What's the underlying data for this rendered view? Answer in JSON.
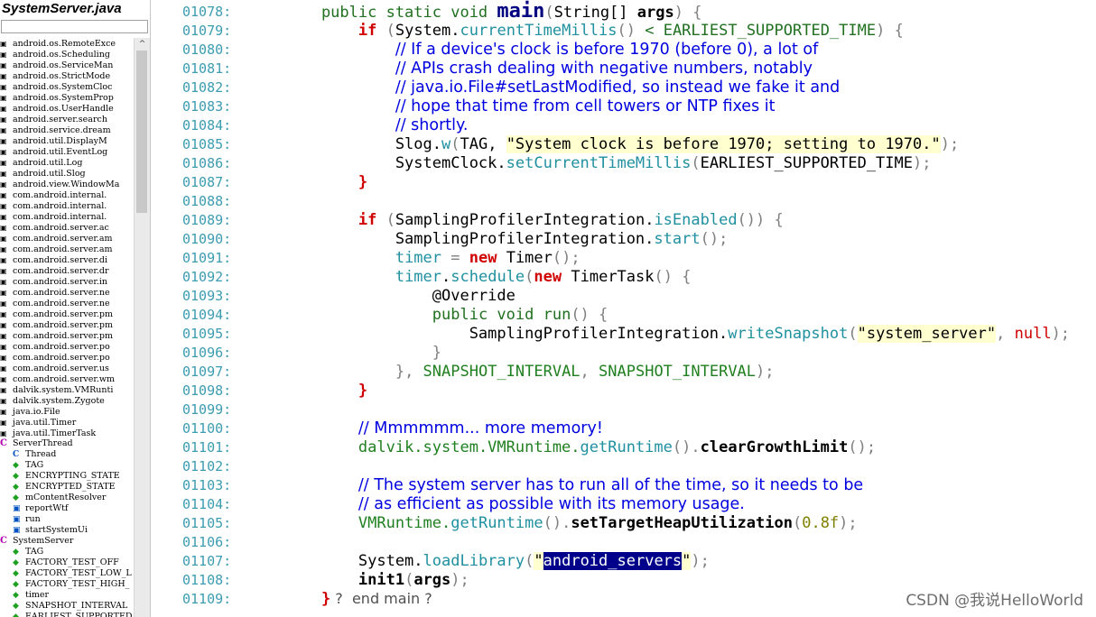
{
  "sidebar": {
    "title": "SystemServer.java",
    "scroll_up": "^",
    "items": [
      {
        "kind": "imp",
        "label": "android.os.RemoteExce"
      },
      {
        "kind": "imp",
        "label": "android.os.Scheduling"
      },
      {
        "kind": "imp",
        "label": "android.os.ServiceMan"
      },
      {
        "kind": "imp",
        "label": "android.os.StrictMode"
      },
      {
        "kind": "imp",
        "label": "android.os.SystemCloc"
      },
      {
        "kind": "imp",
        "label": "android.os.SystemProp"
      },
      {
        "kind": "imp",
        "label": "android.os.UserHandle"
      },
      {
        "kind": "imp",
        "label": "android.server.search"
      },
      {
        "kind": "imp",
        "label": "android.service.dream"
      },
      {
        "kind": "imp",
        "label": "android.util.DisplayM"
      },
      {
        "kind": "imp",
        "label": "android.util.EventLog"
      },
      {
        "kind": "imp",
        "label": "android.util.Log"
      },
      {
        "kind": "imp",
        "label": "android.util.Slog"
      },
      {
        "kind": "imp",
        "label": "android.view.WindowMa"
      },
      {
        "kind": "imp",
        "label": "com.android.internal."
      },
      {
        "kind": "imp",
        "label": "com.android.internal."
      },
      {
        "kind": "imp",
        "label": "com.android.internal."
      },
      {
        "kind": "imp",
        "label": "com.android.server.ac"
      },
      {
        "kind": "imp",
        "label": "com.android.server.am"
      },
      {
        "kind": "imp",
        "label": "com.android.server.am"
      },
      {
        "kind": "imp",
        "label": "com.android.server.di"
      },
      {
        "kind": "imp",
        "label": "com.android.server.dr"
      },
      {
        "kind": "imp",
        "label": "com.android.server.in"
      },
      {
        "kind": "imp",
        "label": "com.android.server.ne"
      },
      {
        "kind": "imp",
        "label": "com.android.server.ne"
      },
      {
        "kind": "imp",
        "label": "com.android.server.pm"
      },
      {
        "kind": "imp",
        "label": "com.android.server.pm"
      },
      {
        "kind": "imp",
        "label": "com.android.server.pm"
      },
      {
        "kind": "imp",
        "label": "com.android.server.po"
      },
      {
        "kind": "imp",
        "label": "com.android.server.po"
      },
      {
        "kind": "imp",
        "label": "com.android.server.us"
      },
      {
        "kind": "imp",
        "label": "com.android.server.wm"
      },
      {
        "kind": "imp",
        "label": "dalvik.system.VMRunti"
      },
      {
        "kind": "imp",
        "label": "dalvik.system.Zygote"
      },
      {
        "kind": "imp",
        "label": "java.io.File"
      },
      {
        "kind": "imp",
        "label": "java.util.Timer"
      },
      {
        "kind": "imp",
        "label": "java.util.TimerTask"
      },
      {
        "kind": "cls",
        "label": "ServerThread"
      },
      {
        "kind": "cls2",
        "label": "Thread"
      },
      {
        "kind": "fld",
        "label": "TAG"
      },
      {
        "kind": "fld",
        "label": "ENCRYPTING_STATE"
      },
      {
        "kind": "fld",
        "label": "ENCRYPTED_STATE"
      },
      {
        "kind": "fld",
        "label": "mContentResolver"
      },
      {
        "kind": "mth",
        "label": "reportWtf"
      },
      {
        "kind": "mth",
        "label": "run"
      },
      {
        "kind": "mth",
        "label": "startSystemUi"
      },
      {
        "kind": "cls",
        "label": "SystemServer"
      },
      {
        "kind": "fld",
        "label": "TAG"
      },
      {
        "kind": "fld",
        "label": "FACTORY_TEST_OFF"
      },
      {
        "kind": "fld",
        "label": "FACTORY_TEST_LOW_L"
      },
      {
        "kind": "fld",
        "label": "FACTORY_TEST_HIGH_"
      },
      {
        "kind": "fld",
        "label": "timer"
      },
      {
        "kind": "fld",
        "label": "SNAPSHOT_INTERVAL"
      },
      {
        "kind": "fld",
        "label": "EARLIEST_SUPPORTED"
      }
    ]
  },
  "code": {
    "lines": [
      {
        "n": "01078:",
        "segs": [
          [
            "kwg",
            "    public static void "
          ],
          [
            "fnb",
            "main"
          ],
          [
            "br",
            "("
          ],
          [
            "",
            "String[] "
          ],
          [
            "fnbb",
            "args"
          ],
          [
            "br",
            ") {"
          ]
        ]
      },
      {
        "n": "01079:",
        "segs": [
          [
            "",
            "        "
          ],
          [
            "kwr",
            "if"
          ],
          [
            "br",
            " ("
          ],
          [
            "",
            "System."
          ],
          [
            "fn",
            "currentTimeMillis"
          ],
          [
            "br",
            "()"
          ],
          [
            "kwg",
            " < EARLIEST_SUPPORTED_TIME"
          ],
          [
            "br",
            ") {"
          ]
        ]
      },
      {
        "n": "01080:",
        "segs": [
          [
            "",
            "            "
          ],
          [
            "cm",
            "// If a device's clock is before 1970 (before 0), a lot of"
          ]
        ]
      },
      {
        "n": "01081:",
        "segs": [
          [
            "",
            "            "
          ],
          [
            "cm",
            "// APIs crash dealing with negative numbers, notably"
          ]
        ]
      },
      {
        "n": "01082:",
        "segs": [
          [
            "",
            "            "
          ],
          [
            "cm",
            "// java.io.File#setLastModified, so instead we fake it and"
          ]
        ]
      },
      {
        "n": "01083:",
        "segs": [
          [
            "",
            "            "
          ],
          [
            "cm",
            "// hope that time from cell towers or NTP fixes it"
          ]
        ]
      },
      {
        "n": "01084:",
        "segs": [
          [
            "",
            "            "
          ],
          [
            "cm",
            "// shortly."
          ]
        ]
      },
      {
        "n": "01085:",
        "segs": [
          [
            "",
            "            Slog."
          ],
          [
            "fn",
            "w"
          ],
          [
            "br",
            "("
          ],
          [
            "",
            "TAG, "
          ],
          [
            "str2",
            "\"System clock is before 1970; setting to 1970.\""
          ],
          [
            "br",
            ");"
          ]
        ]
      },
      {
        "n": "01086:",
        "segs": [
          [
            "",
            "            SystemClock."
          ],
          [
            "fn",
            "setCurrentTimeMillis"
          ],
          [
            "br",
            "("
          ],
          [
            "",
            "EARLIEST_SUPPORTED_TIME"
          ],
          [
            "br",
            ");"
          ]
        ]
      },
      {
        "n": "01087:",
        "segs": [
          [
            "",
            "        "
          ],
          [
            "kwr",
            "}"
          ]
        ]
      },
      {
        "n": "01088:",
        "segs": []
      },
      {
        "n": "01089:",
        "segs": [
          [
            "",
            "        "
          ],
          [
            "kwr",
            "if"
          ],
          [
            "br",
            " ("
          ],
          [
            "",
            "SamplingProfilerIntegration."
          ],
          [
            "fn",
            "isEnabled"
          ],
          [
            "br",
            "()) {"
          ]
        ]
      },
      {
        "n": "01090:",
        "segs": [
          [
            "",
            "            SamplingProfilerIntegration."
          ],
          [
            "fn",
            "start"
          ],
          [
            "br",
            "();"
          ]
        ]
      },
      {
        "n": "01091:",
        "segs": [
          [
            "",
            "            "
          ],
          [
            "fn",
            "timer"
          ],
          [
            "br",
            " = "
          ],
          [
            "kwr",
            "new"
          ],
          [
            "",
            ""
          ],
          [
            "br",
            " "
          ],
          [
            "",
            "Timer"
          ],
          [
            "br",
            "();"
          ]
        ]
      },
      {
        "n": "01092:",
        "segs": [
          [
            "",
            "            "
          ],
          [
            "fn",
            "timer"
          ],
          [
            "",
            "."
          ],
          [
            "fn",
            "schedule"
          ],
          [
            "br",
            "("
          ],
          [
            "kwr",
            "new"
          ],
          [
            "br",
            " "
          ],
          [
            "",
            "TimerTask"
          ],
          [
            "br",
            "() {"
          ]
        ]
      },
      {
        "n": "01093:",
        "segs": [
          [
            "",
            "                @Override"
          ]
        ]
      },
      {
        "n": "01094:",
        "segs": [
          [
            "",
            "                "
          ],
          [
            "kwg",
            "public void "
          ],
          [
            "kwg",
            "run"
          ],
          [
            "br",
            "() {"
          ]
        ]
      },
      {
        "n": "01095:",
        "segs": [
          [
            "",
            "                    SamplingProfilerIntegration."
          ],
          [
            "fn",
            "writeSnapshot"
          ],
          [
            "br",
            "("
          ],
          [
            "str2",
            "\"system_server\""
          ],
          [
            "br",
            ", "
          ],
          [
            "nullk",
            "null"
          ],
          [
            "br",
            ");"
          ]
        ]
      },
      {
        "n": "01096:",
        "segs": [
          [
            "",
            "                "
          ],
          [
            "br",
            "}"
          ]
        ]
      },
      {
        "n": "01097:",
        "segs": [
          [
            "",
            "            "
          ],
          [
            "br",
            "}, "
          ],
          [
            "cst",
            "SNAPSHOT_INTERVAL"
          ],
          [
            "br",
            ", "
          ],
          [
            "cst",
            "SNAPSHOT_INTERVAL"
          ],
          [
            "br",
            ");"
          ]
        ]
      },
      {
        "n": "01098:",
        "segs": [
          [
            "",
            "        "
          ],
          [
            "kwr",
            "}"
          ]
        ]
      },
      {
        "n": "01099:",
        "segs": []
      },
      {
        "n": "01100:",
        "segs": [
          [
            "",
            "        "
          ],
          [
            "cm",
            "// Mmmmmm... more memory!"
          ]
        ]
      },
      {
        "n": "01101:",
        "segs": [
          [
            "",
            "        "
          ],
          [
            "cst",
            "dalvik.system.VMRuntime."
          ],
          [
            "fn",
            "getRuntime"
          ],
          [
            "br",
            "()."
          ],
          [
            "fnbb",
            "clearGrowthLimit"
          ],
          [
            "br",
            "();"
          ]
        ]
      },
      {
        "n": "01102:",
        "segs": []
      },
      {
        "n": "01103:",
        "segs": [
          [
            "",
            "        "
          ],
          [
            "cm",
            "// The system server has to run all of the time, so it needs to be"
          ]
        ]
      },
      {
        "n": "01104:",
        "segs": [
          [
            "",
            "        "
          ],
          [
            "cm",
            "// as efficient as possible with its memory usage."
          ]
        ]
      },
      {
        "n": "01105:",
        "segs": [
          [
            "",
            "        "
          ],
          [
            "cst",
            "VMRuntime."
          ],
          [
            "fn",
            "getRuntime"
          ],
          [
            "br",
            "()."
          ],
          [
            "fnbb",
            "setTargetHeapUtilization"
          ],
          [
            "br",
            "("
          ],
          [
            "num",
            "0.8f"
          ],
          [
            "br",
            ");"
          ]
        ]
      },
      {
        "n": "01106:",
        "segs": []
      },
      {
        "n": "01107:",
        "segs": [
          [
            "",
            "        System."
          ],
          [
            "fn",
            "loadLibrary"
          ],
          [
            "br",
            "("
          ],
          [
            "str2",
            "\""
          ],
          [
            "sel",
            "android_servers"
          ],
          [
            "str2",
            "\""
          ],
          [
            "br",
            ");"
          ]
        ]
      },
      {
        "n": "01108:",
        "segs": [
          [
            "",
            "        "
          ],
          [
            "fnbb",
            "init1"
          ],
          [
            "br",
            "("
          ],
          [
            "fnbb",
            "args"
          ],
          [
            "br",
            ");"
          ]
        ]
      },
      {
        "n": "01109:",
        "segs": [
          [
            "",
            "    "
          ],
          [
            "kwr",
            "}"
          ],
          [
            "cmg",
            " ?  end main ?"
          ]
        ]
      }
    ]
  },
  "watermark": "CSDN @我说HelloWorld"
}
